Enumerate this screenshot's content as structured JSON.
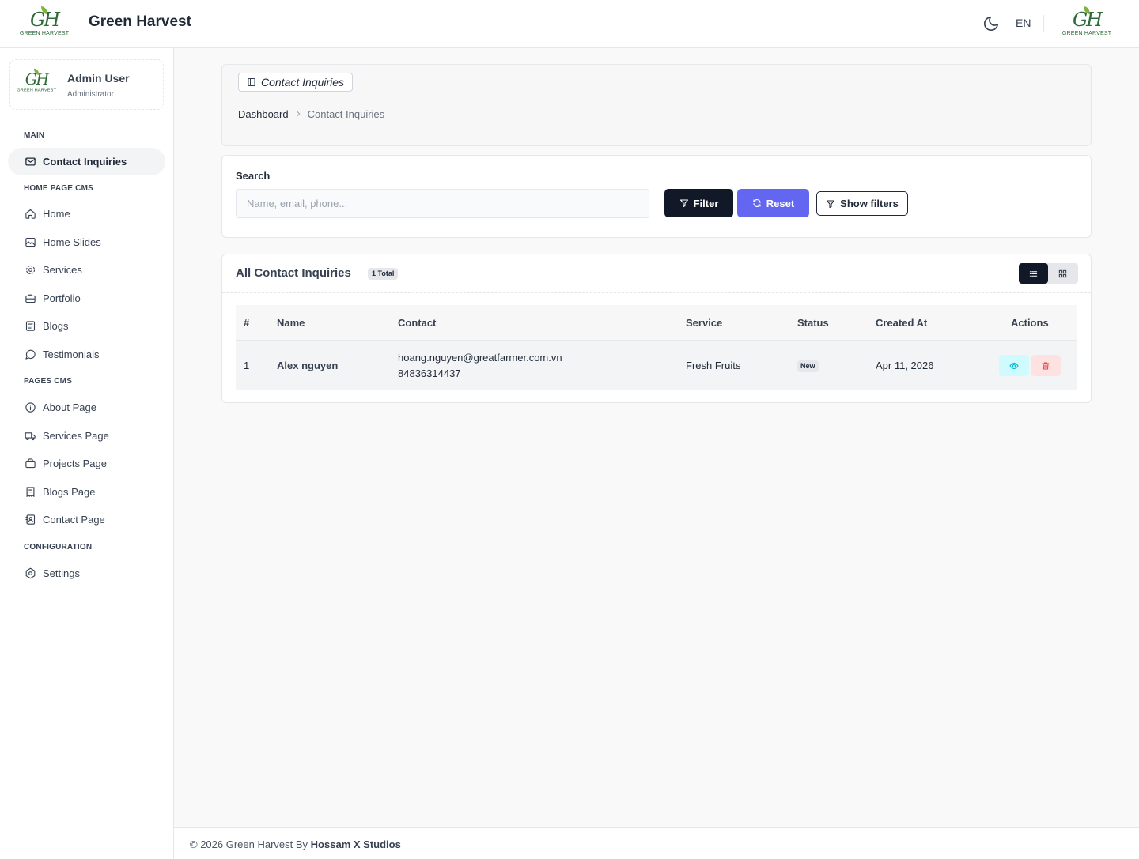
{
  "header": {
    "app_title": "Green Harvest",
    "logo_mark": "GH",
    "logo_text": "GREEN HARVEST",
    "language": "EN"
  },
  "user": {
    "name": "Admin User",
    "role": "Administrator"
  },
  "sidebar": {
    "sections": {
      "main": "MAIN",
      "home_cms": "HOME PAGE CMS",
      "pages_cms": "PAGES CMS",
      "config": "CONFIGURATION"
    },
    "items": [
      {
        "label": "Contact Inquiries",
        "icon": "mail-icon",
        "active": true
      },
      {
        "label": "Home",
        "icon": "home-icon"
      },
      {
        "label": "Home Slides",
        "icon": "image-icon"
      },
      {
        "label": "Services",
        "icon": "gear-icon"
      },
      {
        "label": "Portfolio",
        "icon": "briefcase-icon"
      },
      {
        "label": "Blogs",
        "icon": "document-icon"
      },
      {
        "label": "Testimonials",
        "icon": "chat-icon"
      },
      {
        "label": "About Page",
        "icon": "info-icon"
      },
      {
        "label": "Services Page",
        "icon": "truck-icon"
      },
      {
        "label": "Projects Page",
        "icon": "bag-icon"
      },
      {
        "label": "Blogs Page",
        "icon": "receipt-icon"
      },
      {
        "label": "Contact Page",
        "icon": "contact-book-icon"
      },
      {
        "label": "Settings",
        "icon": "settings-icon"
      }
    ]
  },
  "page": {
    "tag": "Contact Inquiries",
    "breadcrumb": [
      "Dashboard",
      "Contact Inquiries"
    ]
  },
  "search": {
    "label": "Search",
    "placeholder": "Name, email, phone...",
    "value": "",
    "filter_label": "Filter",
    "reset_label": "Reset",
    "show_filters_label": "Show filters"
  },
  "table": {
    "title": "All Contact Inquiries",
    "total_badge": "1 Total",
    "columns": [
      "#",
      "Name",
      "Contact",
      "Service",
      "Status",
      "Created At",
      "Actions"
    ],
    "rows": [
      {
        "index": "1",
        "name": "Alex nguyen",
        "email": "hoang.nguyen@greatfarmer.com.vn",
        "phone": "84836314437",
        "service": "Fresh Fruits",
        "status": "New",
        "created_at": "Apr 11, 2026"
      }
    ]
  },
  "footer": {
    "text": "© 2026 Green Harvest By",
    "brand": "Hossam X Studios"
  },
  "colors": {
    "accent": "#6366f1",
    "dark": "#111827",
    "brand_green": "#2f6b3a",
    "view_btn": "#cffafe",
    "delete_btn": "#fee2e2"
  }
}
